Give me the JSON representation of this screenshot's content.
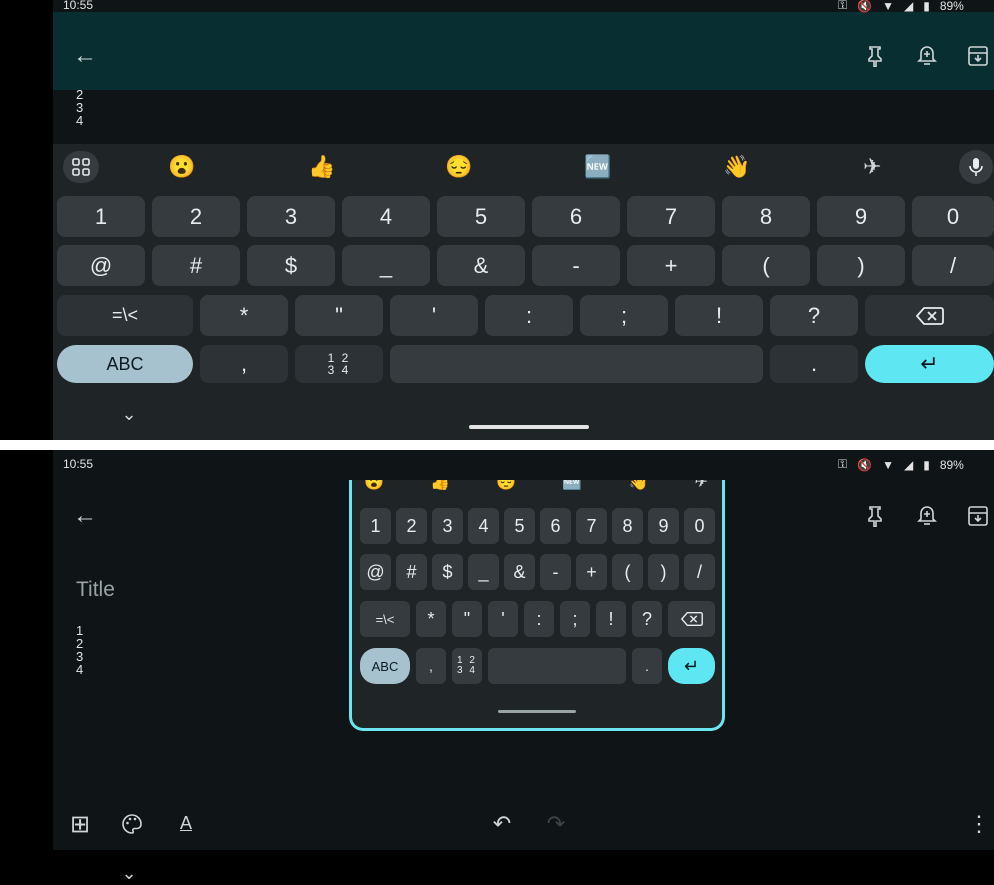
{
  "status": {
    "time": "10:55",
    "battery": "89%"
  },
  "note": {
    "title_placeholder": "Title",
    "lines": [
      "1",
      "2",
      "3",
      "4"
    ],
    "top_lines": [
      "2",
      "3",
      "4"
    ]
  },
  "emoji_row": [
    "😮",
    "👍",
    "😔",
    "🆕",
    "👋",
    "✈"
  ],
  "symbols": {
    "row1": [
      "1",
      "2",
      "3",
      "4",
      "5",
      "6",
      "7",
      "8",
      "9",
      "0"
    ],
    "row2": [
      "@",
      "#",
      "$",
      "_",
      "&",
      "-",
      "+",
      "(",
      ")",
      "/"
    ],
    "row3": [
      "*",
      "\"",
      "'",
      ":",
      ";",
      "!",
      "?"
    ],
    "mode_key": "=\\<",
    "abc_key": "ABC",
    "comma": ",",
    "numpad_key_top": "1 2",
    "numpad_key_bottom": "3 4",
    "period": "."
  },
  "icons": {
    "back": "←",
    "pin": "pin-icon",
    "reminder": "bell-plus-icon",
    "archive": "archive-icon",
    "mic": "mic-icon",
    "backspace": "⌫",
    "enter": "↵",
    "chevron": "⌄",
    "add": "⊞",
    "palette": "palette-icon",
    "text_format": "A",
    "undo": "↶",
    "redo": "↷",
    "more": "⋮"
  },
  "colors": {
    "accent": "#5ee6f2",
    "abc": "#a7c2cf",
    "appbar": "#092e32"
  }
}
